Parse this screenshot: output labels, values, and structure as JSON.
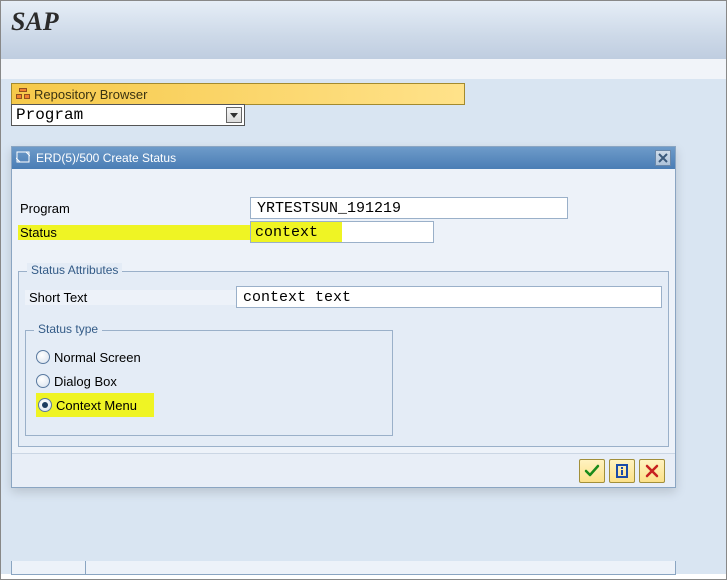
{
  "header": {
    "logo": "SAP"
  },
  "repo": {
    "label": "Repository Browser"
  },
  "selector": {
    "value": "Program"
  },
  "dialog": {
    "title": "ERD(5)/500 Create Status",
    "program_label": "Program",
    "program_value": "YRTESTSUN_191219",
    "status_label": "Status",
    "status_value": "context",
    "attributes_title": "Status Attributes",
    "short_text_label": "Short Text",
    "short_text_value": "context text",
    "status_type_title": "Status type",
    "options": {
      "normal": "Normal Screen",
      "dialog": "Dialog Box",
      "context": "Context Menu"
    }
  }
}
